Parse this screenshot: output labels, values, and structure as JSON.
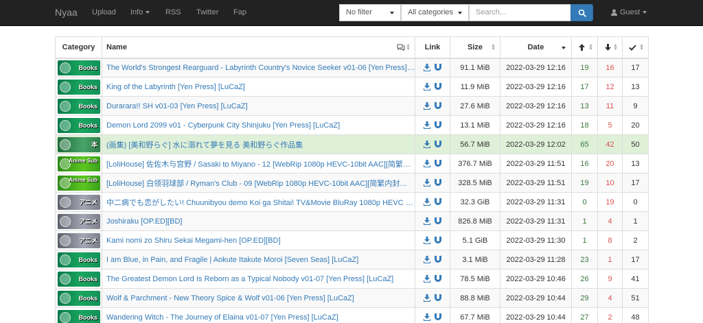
{
  "nav": {
    "brand": "Nyaa",
    "links": [
      "Upload",
      "Info",
      "RSS",
      "Twitter",
      "Fap"
    ],
    "filter": "No filter",
    "category": "All categories",
    "search_placeholder": "Search...",
    "user": "Guest"
  },
  "table": {
    "headers": {
      "category": "Category",
      "name": "Name",
      "link": "Link",
      "size": "Size",
      "date": "Date"
    },
    "rows": [
      {
        "cat": "Books",
        "name": "The World's Strongest Rearguard - Labyrinth Country's Novice Seeker v01-06 [Yen Press] [...",
        "size": "91.1 MiB",
        "date": "2022-03-29 12:16",
        "seeders": "19",
        "leechers": "16",
        "completed": "17"
      },
      {
        "cat": "Books",
        "name": "King of the Labyrinth [Yen Press] [LuCaZ]",
        "size": "11.9 MiB",
        "date": "2022-03-29 12:16",
        "seeders": "17",
        "leechers": "12",
        "completed": "13"
      },
      {
        "cat": "Books",
        "name": "Durarara!! SH v01-03 [Yen Press] [LuCaZ]",
        "size": "27.6 MiB",
        "date": "2022-03-29 12:16",
        "seeders": "13",
        "leechers": "11",
        "completed": "9"
      },
      {
        "cat": "Books",
        "name": "Demon Lord 2099 v01 - Cyberpunk City Shinjuku [Yen Press] [LuCaZ]",
        "size": "13.1 MiB",
        "date": "2022-03-29 12:16",
        "seeders": "18",
        "leechers": "5",
        "completed": "20"
      },
      {
        "cat": "本",
        "name": "(画集) [美和野らぐ] 水に溺れて夢を見る 美和野らぐ作品集",
        "size": "56.7 MiB",
        "date": "2022-03-29 12:02",
        "seeders": "65",
        "leechers": "42",
        "completed": "50"
      },
      {
        "cat": "Anime Sub",
        "name": "[LoliHouse] 佐佐木与宫野 / Sasaki to Miyano - 12 [WebRip 1080p HEVC-10bit AAC][简繁内...",
        "size": "376.7 MiB",
        "date": "2022-03-29 11:51",
        "seeders": "16",
        "leechers": "20",
        "completed": "13"
      },
      {
        "cat": "Anime Sub",
        "name": "[LoliHouse] 白领羽球部 / Ryman's Club - 09 [WebRip 1080p HEVC-10bit AAC][简繁内封字幕]",
        "size": "328.5 MiB",
        "date": "2022-03-29 11:51",
        "seeders": "19",
        "leechers": "10",
        "completed": "17"
      },
      {
        "cat": "アニメ",
        "name": "中二病でも恋がしたい! Chuunibyou demo Koi ga Shitai! TV&Movie BluRay 1080p HEVC 10...",
        "size": "32.3 GiB",
        "date": "2022-03-29 11:31",
        "seeders": "0",
        "leechers": "19",
        "completed": "0"
      },
      {
        "cat": "アニメ",
        "name": "Joshiraku [OP.ED][BD]",
        "size": "826.8 MiB",
        "date": "2022-03-29 11:31",
        "seeders": "1",
        "leechers": "4",
        "completed": "1"
      },
      {
        "cat": "アニメ",
        "name": "Kami nomi zo Shiru Sekai Megami-hen [OP.ED][BD]",
        "size": "5.1 GiB",
        "date": "2022-03-29 11:30",
        "seeders": "1",
        "leechers": "8",
        "completed": "2"
      },
      {
        "cat": "Books",
        "name": "I am Blue, in Pain, and Fragile | Aokute Itakute Moroi [Seven Seas] [LuCaZ]",
        "size": "3.1 MiB",
        "date": "2022-03-29 11:28",
        "seeders": "23",
        "leechers": "1",
        "completed": "17"
      },
      {
        "cat": "Books",
        "name": "The Greatest Demon Lord Is Reborn as a Typical Nobody v01-07 [Yen Press] [LuCaZ]",
        "size": "78.5 MiB",
        "date": "2022-03-29 10:46",
        "seeders": "26",
        "leechers": "9",
        "completed": "41"
      },
      {
        "cat": "Books",
        "name": "Wolf & Parchment - New Theory Spice & Wolf v01-06 [Yen Press] [LuCaZ]",
        "size": "88.8 MiB",
        "date": "2022-03-29 10:44",
        "seeders": "29",
        "leechers": "4",
        "completed": "51"
      },
      {
        "cat": "Books",
        "name": "Wandering Witch - The Journey of Elaina v01-07 [Yen Press] [LuCaZ]",
        "size": "67.7 MiB",
        "date": "2022-03-29 10:44",
        "seeders": "27",
        "leechers": "2",
        "completed": "48"
      }
    ]
  },
  "colors": {
    "navbar": "#222222",
    "link": "#337ab7",
    "seeders": "#3c763d",
    "leechers": "#d9534f",
    "highlight_row": "#dff0d8"
  }
}
